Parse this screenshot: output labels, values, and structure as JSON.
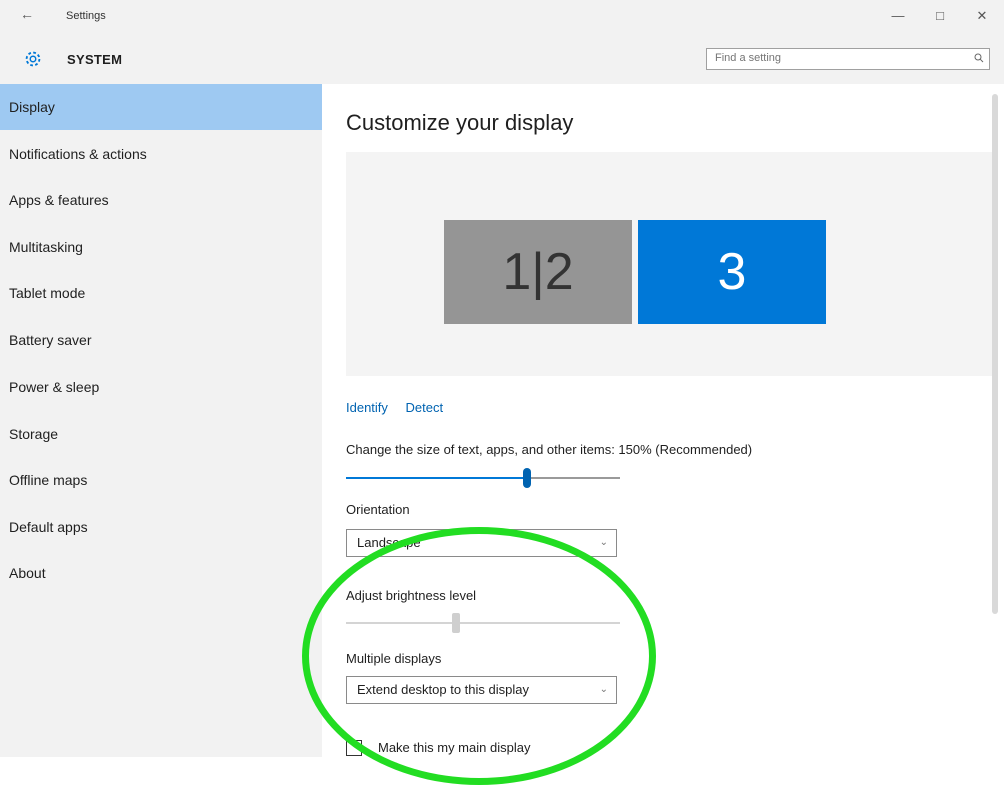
{
  "window": {
    "title": "Settings",
    "back_glyph": "←",
    "minimize": "—",
    "maximize": "□",
    "close": "✕"
  },
  "header": {
    "section": "SYSTEM",
    "search_placeholder": "Find a setting"
  },
  "sidebar": {
    "items": [
      {
        "label": "Display",
        "active": true
      },
      {
        "label": "Notifications & actions"
      },
      {
        "label": "Apps & features"
      },
      {
        "label": "Multitasking"
      },
      {
        "label": "Tablet mode"
      },
      {
        "label": "Battery saver"
      },
      {
        "label": "Power & sleep"
      },
      {
        "label": "Storage"
      },
      {
        "label": "Offline maps"
      },
      {
        "label": "Default apps"
      },
      {
        "label": "About"
      }
    ]
  },
  "main": {
    "title": "Customize your display",
    "monitors": [
      {
        "label": "1|2",
        "selected": false
      },
      {
        "label": "3",
        "selected": true
      }
    ],
    "identify_link": "Identify",
    "detect_link": "Detect",
    "scale_label": "Change the size of text, apps, and other items: 150% (Recommended)",
    "scale_fraction": 0.66,
    "orientation_label": "Orientation",
    "orientation_value": "Landscape",
    "brightness_label": "Adjust brightness level",
    "brightness_fraction": 0.4,
    "multiple_displays_label": "Multiple displays",
    "multiple_displays_value": "Extend desktop to this display",
    "main_display_checkbox_label": "Make this my main display",
    "main_display_checked": false
  },
  "colors": {
    "accent": "#0078d7",
    "sidebar_selected": "#9ec9f2",
    "annotation": "#22dd22"
  }
}
